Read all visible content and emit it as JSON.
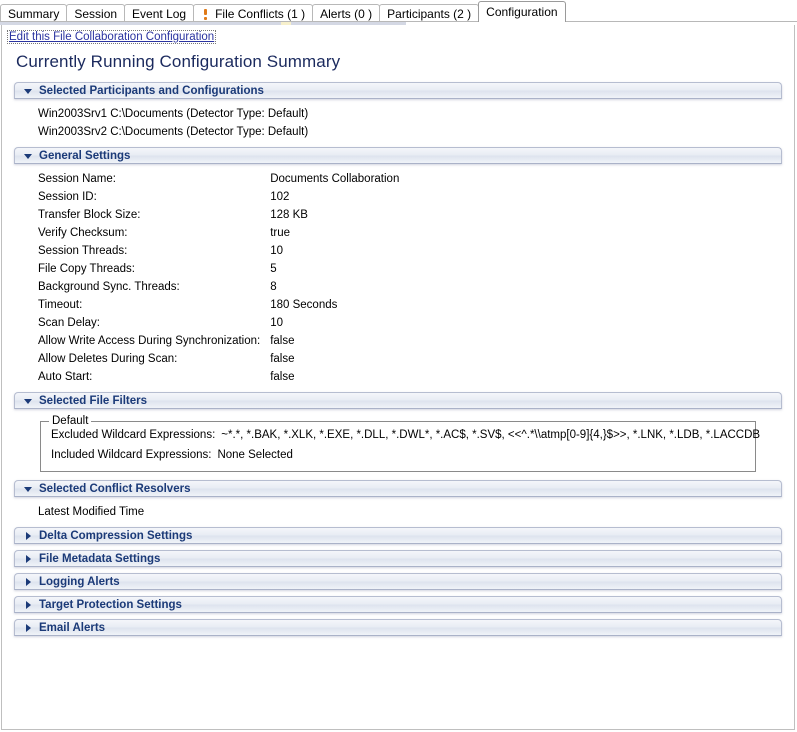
{
  "tabs": [
    {
      "label": "Summary",
      "icon": null,
      "active": false
    },
    {
      "label": "Session",
      "icon": null,
      "active": false
    },
    {
      "label": "Event Log",
      "icon": null,
      "active": false
    },
    {
      "label": "File Conflicts (1 )",
      "icon": "warning-exclamation-icon",
      "active": false
    },
    {
      "label": "Alerts (0 )",
      "icon": null,
      "active": false
    },
    {
      "label": "Participants (2 )",
      "icon": null,
      "active": false
    },
    {
      "label": "Configuration",
      "icon": null,
      "active": true
    }
  ],
  "edit_link": "Edit this File Collaboration Configuration",
  "page_title": "Currently Running Configuration Summary",
  "colors": {
    "title": "#1b2a5e",
    "section_title": "#1b3a78",
    "link": "#2a33a0",
    "warning_icon": "#e07a18"
  },
  "sections": {
    "participants": {
      "title": "Selected Participants and Configurations",
      "expanded": true,
      "rows": [
        "Win2003Srv1  C:\\Documents (Detector Type: Default)",
        "Win2003Srv2  C:\\Documents (Detector Type: Default)"
      ]
    },
    "general": {
      "title": "General Settings",
      "expanded": true,
      "rows": [
        {
          "key": "Session Name:",
          "value": "Documents Collaboration"
        },
        {
          "key": "Session ID:",
          "value": "102"
        },
        {
          "key": "Transfer Block Size:",
          "value": "128 KB"
        },
        {
          "key": "Verify Checksum:",
          "value": "true"
        },
        {
          "key": "Session Threads:",
          "value": "10"
        },
        {
          "key": "File Copy Threads:",
          "value": "5"
        },
        {
          "key": "Background Sync. Threads:",
          "value": "8"
        },
        {
          "key": "Timeout:",
          "value": "180 Seconds"
        },
        {
          "key": "Scan Delay:",
          "value": "10"
        },
        {
          "key": "Allow Write Access During Synchronization:",
          "value": "false"
        },
        {
          "key": "Allow Deletes During Scan:",
          "value": "false"
        },
        {
          "key": "Auto Start:",
          "value": "false"
        }
      ]
    },
    "filters": {
      "title": "Selected File Filters",
      "expanded": true,
      "group_legend": "Default",
      "excluded_label": "Excluded Wildcard Expressions:",
      "excluded_value": "~*.*, *.BAK, *.XLK, *.EXE, *.DLL, *.DWL*, *.AC$, *.SV$, <<^.*\\\\atmp[0-9]{4,}$>>, *.LNK, *.LDB, *.LACCDB",
      "included_label": "Included Wildcard Expressions:",
      "included_value": "None Selected"
    },
    "resolvers": {
      "title": "Selected Conflict Resolvers",
      "expanded": true,
      "rows": [
        "Latest Modified Time"
      ]
    },
    "collapsed": [
      {
        "title": "Delta Compression Settings",
        "expanded": false
      },
      {
        "title": "File Metadata Settings",
        "expanded": false
      },
      {
        "title": "Logging Alerts",
        "expanded": false
      },
      {
        "title": "Target Protection Settings",
        "expanded": false
      },
      {
        "title": "Email Alerts",
        "expanded": false
      }
    ]
  }
}
